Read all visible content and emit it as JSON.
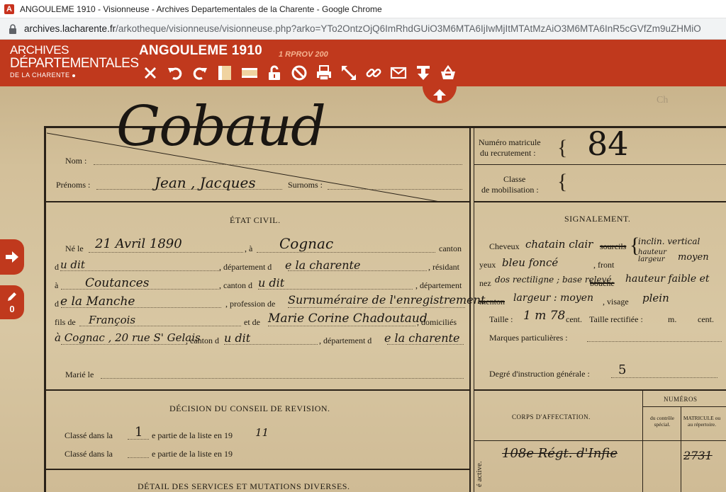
{
  "browser": {
    "window_title": "ANGOULEME 1910 - Visionneuse - Archives Departementales de la Charente - Google Chrome",
    "url_host": "archives.lacharente.fr",
    "url_path": "/arkotheque/visionneuse/visionneuse.php?arko=YTo2OntzOjQ6ImRhdGUiO3M6MTA6IjIwMjItMTAtMzAiO3M6MTA6InR5cGVfZm9uZHMiO"
  },
  "app": {
    "logo_line1": "ARCHIVES",
    "logo_line2": "DÉPARTEMENTALES",
    "logo_line3": "DE LA CHARENTE",
    "doc_title": "ANGOULEME 1910",
    "doc_cote": "1 RPROV 200",
    "brand_color": "#c0391d",
    "toolbar": [
      {
        "name": "close-icon"
      },
      {
        "name": "rotate-left-icon"
      },
      {
        "name": "rotate-right-icon"
      },
      {
        "name": "fit-height-icon"
      },
      {
        "name": "fit-width-icon"
      },
      {
        "name": "unlock-icon"
      },
      {
        "name": "forbidden-icon"
      },
      {
        "name": "print-icon"
      },
      {
        "name": "fullscreen-icon"
      },
      {
        "name": "link-icon"
      },
      {
        "name": "mail-icon"
      },
      {
        "name": "download-icon"
      },
      {
        "name": "basket-icon"
      }
    ],
    "annotation_count": "0"
  },
  "document": {
    "label_nom": "Nom :",
    "label_prenoms": "Prénoms :",
    "label_surnoms": "Surnoms :",
    "name": "Gobaud",
    "prenoms": "Jean , Jacques",
    "label_numero": "Numéro matricule",
    "label_recrutement": "du recrutement :",
    "numero": "84",
    "label_classe": "Classe",
    "label_mobilisation": "de mobilisation :",
    "etat_civil_title": "ÉTAT CIVIL.",
    "ne_le": "Né le",
    "birth_date": "21 Avril 1890",
    "a": ", à",
    "birth_place": "Cognac",
    "canton": "canton",
    "du": "d",
    "du_value": "u dit",
    "departement_de": ", département d",
    "dept_value": "e la charente",
    "residant": ", résidant",
    "a2": "à",
    "residence": "Coutances",
    "canton_de": ", canton d",
    "canton_value": "u dit",
    "departement": ", département",
    "de": "d",
    "de_value": "e la Manche",
    "profession_de": ", profession de",
    "profession": "Surnuméraire de l'enregistrement",
    "fils_de": "fils de",
    "father": "François",
    "et_de": "et de",
    "mother": "Marie Corine Chadoutaud",
    "domicilies": ", domiciliés",
    "domicile": "à Cognac , 20 rue S' Gelais",
    "canton_d2": ", canton d",
    "canton2": "u dit",
    "departement_d2": ", département d",
    "dept2": "e la charente",
    "marie_le": "Marié le",
    "signalement_title": "SIGNALEMENT.",
    "cheveux": "Cheveux",
    "cheveux_value": "chatain clair",
    "sourcils": "sourcils",
    "yeux": "yeux",
    "yeux_value": "bleu foncé",
    "front": ", front",
    "front_value": "inclin. vertical",
    "hauteur_largeur": "hauteur largeur",
    "moyen": "moyen",
    "nez": "nez",
    "nez_value": "dos rectiligne ; base relevé",
    "bouche": "bouche",
    "hauteur_value": "hauteur faible et",
    "menton": "menton",
    "largeur_value": "largeur : moyen",
    "visage": ", visage",
    "visage_value": "plein",
    "taille": "Taille :",
    "taille_value": "1 m 78",
    "cent": "cent.",
    "taille_rectifiee": "Taille rectifiée :",
    "m": "m.",
    "cent2": "cent.",
    "marques": "Marques particulières :",
    "degre": "Degré d'instruction générale :",
    "degre_value": "5",
    "decision_title": "DÉCISION DU CONSEIL DE REVISION.",
    "classe_dans_la": "Classé dans la",
    "classe_value": "1",
    "partie_liste": "e partie de la liste en 19",
    "annee_value": "11",
    "classe_dans_la2": "Classé dans la",
    "partie_liste2": "e partie de la liste en 19",
    "numeros": "NUMÉROS",
    "corps": "CORPS D'AFFECTATION.",
    "du_controle": "du contrôle spécial.",
    "matricule_repertoire": "MATRICULE ou au répertoire.",
    "active": "é active.",
    "regiment": "108e Régt. d'Infie",
    "regiment_num": "2731",
    "detail_title": "DÉTAIL DES SERVICES ET MUTATIONS DIVERSES.",
    "margin_mark": "Ch"
  }
}
